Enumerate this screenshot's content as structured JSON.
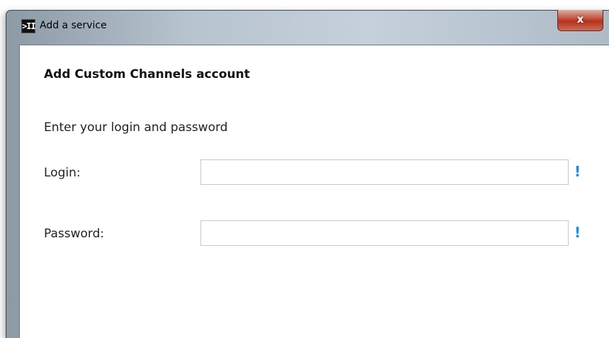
{
  "window": {
    "title": "Add a service",
    "app_icon_glyph": ">II",
    "close_glyph": "x"
  },
  "dialog": {
    "heading": "Add Custom Channels account",
    "instruction": "Enter your login and password",
    "fields": [
      {
        "label": "Login:",
        "value": "",
        "placeholder": "",
        "required_mark": "!"
      },
      {
        "label": "Password:",
        "value": "",
        "placeholder": "",
        "required_mark": "!"
      }
    ]
  },
  "colors": {
    "required_mark": "#1e8ce6",
    "close_button": "#c24b35"
  }
}
